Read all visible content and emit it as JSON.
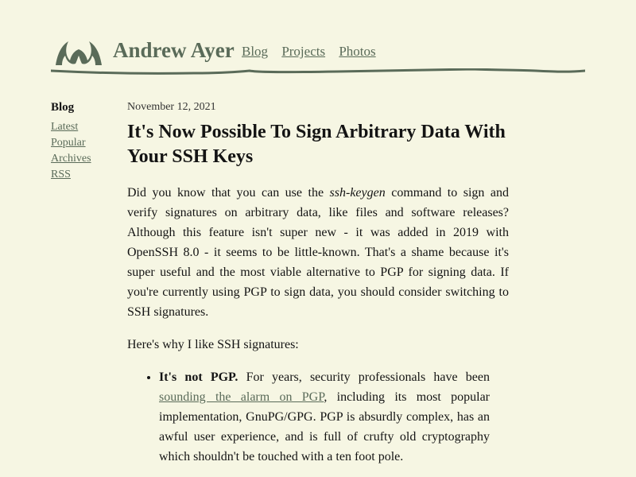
{
  "header": {
    "site_title": "Andrew Ayer",
    "logo_icon": "andrew-ayer-logo",
    "nav": [
      {
        "label": "Blog"
      },
      {
        "label": "Projects"
      },
      {
        "label": "Photos"
      }
    ]
  },
  "sidebar": {
    "heading": "Blog",
    "links": [
      {
        "label": "Latest"
      },
      {
        "label": "Popular"
      },
      {
        "label": "Archives"
      },
      {
        "label": "RSS"
      }
    ]
  },
  "post": {
    "date": "November 12, 2021",
    "title": "It's Now Possible To Sign Arbitrary Data With Your SSH Keys",
    "intro": {
      "before": "Did you know that you can use the ",
      "command": "ssh-keygen",
      "after": " command to sign and verify signatures on arbitrary data, like files and software releases? Although this feature isn't super new - it was added in 2019 with OpenSSH 8.0 - it seems to be little-known. That's a shame because it's super useful and the most viable alternative to PGP for signing data. If you're currently using PGP to sign data, you should consider switching to SSH signatures."
    },
    "why_line": "Here's why I like SSH signatures:",
    "reasons": [
      {
        "heading": "It's not PGP.",
        "text_before": " For years, security professionals have been ",
        "link_text": "sounding the alarm on PGP",
        "text_after": ", including its most popular implementation, GnuPG/GPG. PGP is absurdly complex, has an awful user experience, and is full of crufty old cryptography which shouldn't be touched with a ten foot pole."
      }
    ]
  },
  "colors": {
    "background": "#f6f6e3",
    "accent": "#5a6b59",
    "text": "#141414"
  }
}
